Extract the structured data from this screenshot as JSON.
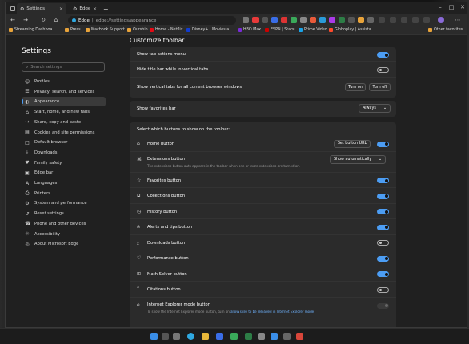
{
  "tabs": [
    {
      "label": "Settings"
    },
    {
      "label": "Edge"
    }
  ],
  "address": {
    "site_label": "Edge",
    "url": "edge://settings/appearance"
  },
  "bookmarks": [
    {
      "label": "Streaming Dashboa...",
      "color": "#e8a33a"
    },
    {
      "label": "Press",
      "color": "#e8a33a"
    },
    {
      "label": "Macbook Support",
      "color": "#e8a33a"
    },
    {
      "label": "Ourshin",
      "color": "#e8a33a"
    },
    {
      "label": "Home - Netflix",
      "color": "#e50914"
    },
    {
      "label": "Disney+ | Movies a...",
      "color": "#113ccf"
    },
    {
      "label": "HBO Max",
      "color": "#7a2bd8"
    },
    {
      "label": "ESPN | Stars",
      "color": "#cc0000"
    },
    {
      "label": "Prime Video",
      "color": "#1aa3e8"
    },
    {
      "label": "Globoplay | Assista...",
      "color": "#ff4a2b"
    },
    {
      "label": "Other favorites",
      "color": "#e8a33a"
    }
  ],
  "sidebar": {
    "title": "Settings",
    "search_placeholder": "Search settings",
    "items": [
      {
        "label": "Profiles",
        "icon": "person-icon",
        "glyph": "☺"
      },
      {
        "label": "Privacy, search, and services",
        "icon": "lock-icon",
        "glyph": "☰"
      },
      {
        "label": "Appearance",
        "icon": "brush-icon",
        "glyph": "◐"
      },
      {
        "label": "Start, home, and new tabs",
        "icon": "home-icon",
        "glyph": "⌂"
      },
      {
        "label": "Share, copy and paste",
        "icon": "share-icon",
        "glyph": "↪"
      },
      {
        "label": "Cookies and site permissions",
        "icon": "cookie-icon",
        "glyph": "▤"
      },
      {
        "label": "Default browser",
        "icon": "browser-icon",
        "glyph": "□"
      },
      {
        "label": "Downloads",
        "icon": "download-icon",
        "glyph": "⤓"
      },
      {
        "label": "Family safety",
        "icon": "family-icon",
        "glyph": "♥"
      },
      {
        "label": "Edge bar",
        "icon": "edgebar-icon",
        "glyph": "▣"
      },
      {
        "label": "Languages",
        "icon": "language-icon",
        "glyph": "A"
      },
      {
        "label": "Printers",
        "icon": "printer-icon",
        "glyph": "⎙"
      },
      {
        "label": "System and performance",
        "icon": "system-icon",
        "glyph": "⚙"
      },
      {
        "label": "Reset settings",
        "icon": "reset-icon",
        "glyph": "↺"
      },
      {
        "label": "Phone and other devices",
        "icon": "phone-icon",
        "glyph": "☎"
      },
      {
        "label": "Accessibility",
        "icon": "accessibility-icon",
        "glyph": "☼"
      },
      {
        "label": "About Microsoft Edge",
        "icon": "edge-logo-icon",
        "glyph": "◎"
      }
    ],
    "active_index": 2
  },
  "main": {
    "section_title": "Customize toolbar",
    "card1": {
      "rows": [
        {
          "label": "Show tab actions menu",
          "toggle": "on"
        },
        {
          "label": "Hide title bar while in vertical tabs",
          "toggle": "off"
        },
        {
          "label": "Show vertical tabs for all current browser windows",
          "btn1": "Turn on",
          "btn2": "Turn off"
        }
      ]
    },
    "favorites_bar": {
      "label": "Show favorites bar",
      "value": "Always"
    },
    "buttons_header": "Select which buttons to show on the toolbar:",
    "buttons": [
      {
        "label": "Home button",
        "icon": "home-icon",
        "glyph": "⌂",
        "toggle": "on",
        "extra_button": "Set button URL"
      },
      {
        "label": "Extensions button",
        "icon": "puzzle-icon",
        "glyph": "⌘",
        "dropdown": "Show automatically",
        "sub": "The extensions button auto appears in the toolbar when one or more extensions are turned on."
      },
      {
        "label": "Favorites button",
        "icon": "star-icon",
        "glyph": "☆",
        "toggle": "on"
      },
      {
        "label": "Collections button",
        "icon": "collections-icon",
        "glyph": "⧉",
        "toggle": "on"
      },
      {
        "label": "History button",
        "icon": "history-icon",
        "glyph": "◷",
        "toggle": "on"
      },
      {
        "label": "Alerts and tips button",
        "icon": "bell-icon",
        "glyph": "⍾",
        "toggle": "on"
      },
      {
        "label": "Downloads button",
        "icon": "download-icon",
        "glyph": "⤓",
        "toggle": "off"
      },
      {
        "label": "Performance button",
        "icon": "heart-pulse-icon",
        "glyph": "♡",
        "toggle": "on"
      },
      {
        "label": "Math Solver button",
        "icon": "math-icon",
        "glyph": "⊞",
        "toggle": "on"
      },
      {
        "label": "Citations button",
        "icon": "quote-icon",
        "glyph": "”",
        "toggle": "off"
      },
      {
        "label": "Internet Explorer mode button",
        "icon": "ie-icon",
        "glyph": "e",
        "toggle": "disabled",
        "sub_prefix": "To show the Internet Explorer mode button, turn on ",
        "sub_link": "allow sites to be reloaded in Internet Explorer mode"
      }
    ]
  },
  "colors": {
    "accent": "#4c9df3",
    "background": "#202020",
    "card": "#2b2b2b"
  }
}
